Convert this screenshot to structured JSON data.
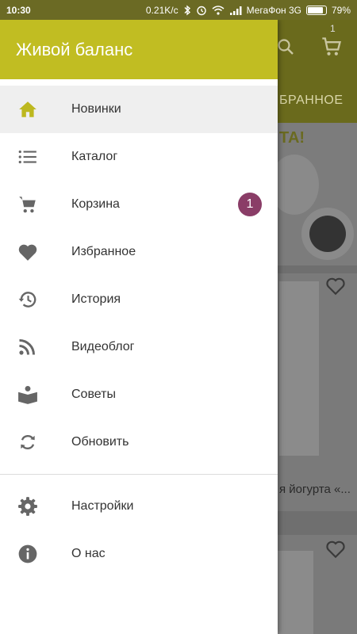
{
  "status_bar": {
    "time": "10:30",
    "speed": "0.21K/c",
    "carrier": "МегаФон 3G",
    "battery": "79%",
    "battery_level": 0.79
  },
  "background": {
    "tab_label": "БРАННОЕ",
    "cart_count": "1",
    "banner_text": "ТА!",
    "product_caption": "я йогурта «..."
  },
  "drawer": {
    "title": "Живой баланс",
    "accent_color": "#c1bd22",
    "badge_color": "#8a3d67",
    "items": [
      {
        "label": "Новинки",
        "icon": "home-icon",
        "active": true
      },
      {
        "label": "Каталог",
        "icon": "list-icon"
      },
      {
        "label": "Корзина",
        "icon": "cart-icon",
        "badge": "1"
      },
      {
        "label": "Избранное",
        "icon": "heart-icon"
      },
      {
        "label": "История",
        "icon": "history-icon"
      },
      {
        "label": "Видеоблог",
        "icon": "rss-icon"
      },
      {
        "label": "Советы",
        "icon": "book-reader-icon"
      },
      {
        "label": "Обновить",
        "icon": "sync-icon"
      }
    ],
    "secondary_items": [
      {
        "label": "Настройки",
        "icon": "gear-icon"
      },
      {
        "label": "О нас",
        "icon": "info-icon"
      }
    ]
  }
}
